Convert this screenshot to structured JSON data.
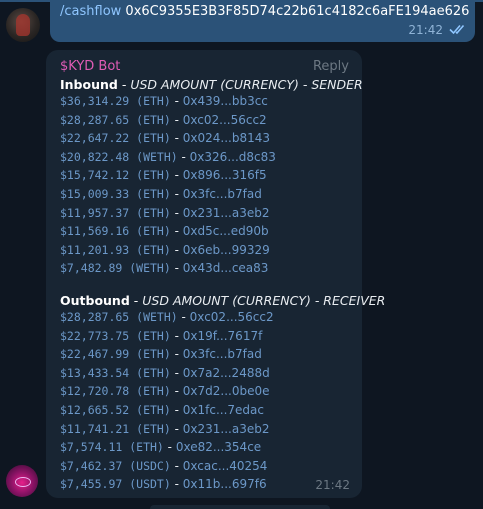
{
  "outgoing": {
    "command": "/cashflow",
    "address": "0x6C9355E3B3F85D74c22b61c4182c6aFE194ae626",
    "time": "21:42"
  },
  "incoming": {
    "bot_name": "$KYD Bot",
    "reply_label": "Reply",
    "time": "21:42",
    "inbound": {
      "title": "Inbound",
      "format": "USD AMOUNT (CURRENCY) - SENDER",
      "rows": [
        {
          "amount": "$36,314.29 (ETH)",
          "address": "0x439...bb3cc"
        },
        {
          "amount": "$28,287.65 (ETH)",
          "address": "0xc02...56cc2"
        },
        {
          "amount": "$22,647.22 (ETH)",
          "address": "0x024...b8143"
        },
        {
          "amount": "$20,822.48 (WETH)",
          "address": "0x326...d8c83"
        },
        {
          "amount": "$15,742.12 (ETH)",
          "address": "0x896...316f5"
        },
        {
          "amount": "$15,009.33 (ETH)",
          "address": "0x3fc...b7fad"
        },
        {
          "amount": "$11,957.37 (ETH)",
          "address": "0x231...a3eb2"
        },
        {
          "amount": "$11,569.16 (ETH)",
          "address": "0xd5c...ed90b"
        },
        {
          "amount": "$11,201.93 (ETH)",
          "address": "0x6eb...99329"
        },
        {
          "amount": "$7,482.89 (WETH)",
          "address": "0x43d...cea83"
        }
      ]
    },
    "outbound": {
      "title": "Outbound",
      "format": "USD AMOUNT (CURRENCY) - RECEIVER",
      "rows": [
        {
          "amount": "$28,287.65 (WETH)",
          "address": "0xc02...56cc2"
        },
        {
          "amount": "$22,773.75 (ETH)",
          "address": "0x19f...7617f"
        },
        {
          "amount": "$22,467.99 (ETH)",
          "address": "0x3fc...b7fad"
        },
        {
          "amount": "$13,433.54 (ETH)",
          "address": "0x7a2...2488d"
        },
        {
          "amount": "$12,720.78 (ETH)",
          "address": "0x7d2...0be0e"
        },
        {
          "amount": "$12,665.52 (ETH)",
          "address": "0x1fc...7edac"
        },
        {
          "amount": "$11,741.21 (ETH)",
          "address": "0x231...a3eb2"
        },
        {
          "amount": "$7,574.11 (ETH)",
          "address": "0xe82...354ce"
        },
        {
          "amount": "$7,462.37 (USDC)",
          "address": "0xcac...40254"
        },
        {
          "amount": "$7,455.97 (USDT)",
          "address": "0x11b...697f6"
        }
      ]
    }
  },
  "colors": {
    "background": "#0e1621",
    "outgoing_bubble": "#2b5278",
    "incoming_bubble": "#182533",
    "bot_name": "#e05cb5",
    "link": "#6c98c8"
  }
}
